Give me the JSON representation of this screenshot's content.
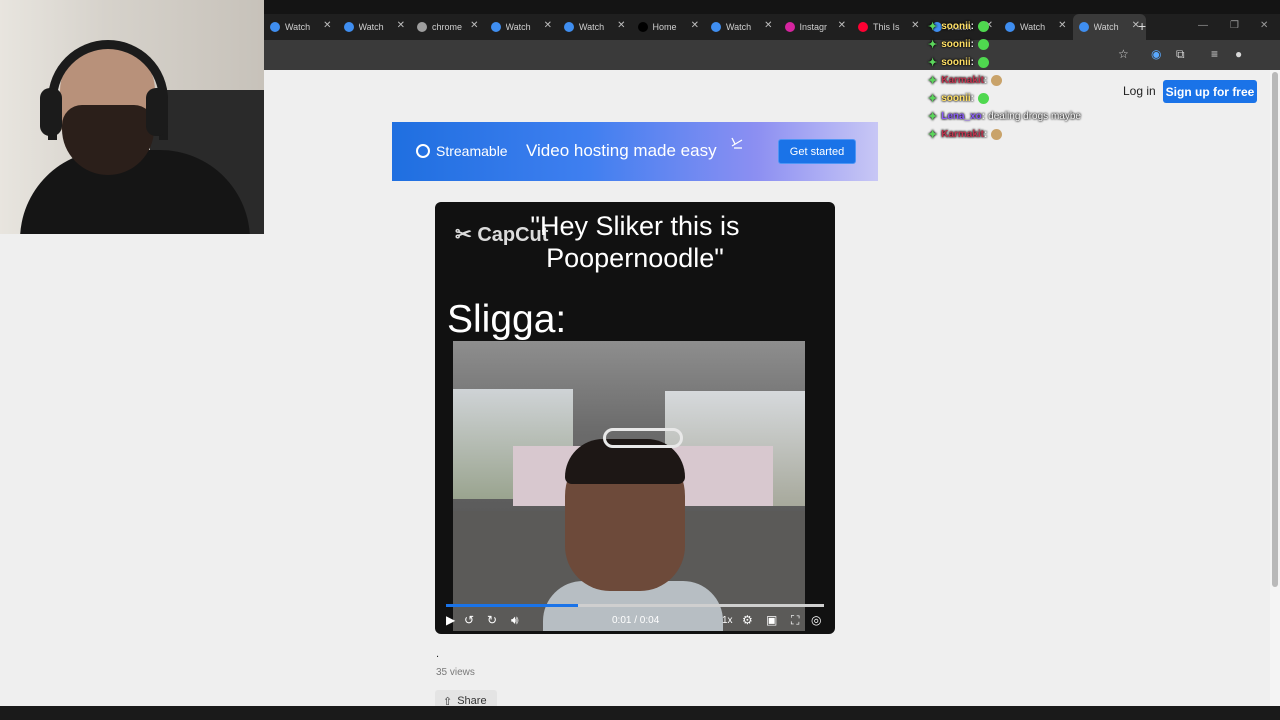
{
  "browser": {
    "tabs": [
      {
        "title": "Watch",
        "icon": "streamable-icon",
        "color": "#3f8ef0",
        "active": false
      },
      {
        "title": "Watch",
        "icon": "streamable-icon",
        "color": "#3f8ef0",
        "active": false
      },
      {
        "title": "chrome",
        "icon": "chrome-icon",
        "color": "#9e9e9e",
        "active": false
      },
      {
        "title": "Watch",
        "icon": "streamable-icon",
        "color": "#3f8ef0",
        "active": false
      },
      {
        "title": "Watch",
        "icon": "streamable-icon",
        "color": "#3f8ef0",
        "active": false
      },
      {
        "title": "Home",
        "icon": "x-icon",
        "color": "#000000",
        "active": false
      },
      {
        "title": "Watch",
        "icon": "streamable-icon",
        "color": "#3f8ef0",
        "active": false
      },
      {
        "title": "Instagr",
        "icon": "instagram-icon",
        "color": "#d6249f",
        "active": false
      },
      {
        "title": "This Is",
        "icon": "youtube-icon",
        "color": "#ff0033",
        "active": false
      },
      {
        "title": "Watch",
        "icon": "streamable-icon",
        "color": "#3f8ef0",
        "active": false
      },
      {
        "title": "Watch",
        "icon": "streamable-icon",
        "color": "#3f8ef0",
        "active": false
      },
      {
        "title": "Watch",
        "icon": "streamable-icon",
        "color": "#3f8ef0",
        "active": true
      }
    ],
    "tab_close": "✕",
    "new_tab": "+"
  },
  "header": {
    "login_label": "Log in",
    "signup_label": "Sign up for free"
  },
  "chat": [
    {
      "user": "soonii",
      "color": "#ffe066",
      "emote_color": "#4fd84f",
      "message": ""
    },
    {
      "user": "soonii",
      "color": "#ffe066",
      "emote_color": "#4fd84f",
      "message": ""
    },
    {
      "user": "soonii",
      "color": "#ffe066",
      "emote_color": "#4fd84f",
      "message": ""
    },
    {
      "user": "Karmakit",
      "color": "#c0334e",
      "emote_color": "#c9a36a",
      "message": ""
    },
    {
      "user": "soonii",
      "color": "#ffe066",
      "emote_color": "#4fd84f",
      "message": ""
    },
    {
      "user": "Lena_xo",
      "color": "#8a5cf6",
      "emote_color": "",
      "message": "dealing drogs maybe"
    },
    {
      "user": "Karmakit",
      "color": "#c0334e",
      "emote_color": "#c9a36a",
      "message": ""
    }
  ],
  "banner": {
    "brand": "Streamable",
    "tagline": "Video hosting made easy",
    "cta": "Get started"
  },
  "video": {
    "watermark": "CapCut",
    "caption_line1": "\"Hey Sliker this is",
    "caption_line2": "Poopernoodle\"",
    "speaker": "Sligga:",
    "time": "0:01 / 0:04",
    "speed": "1x",
    "progress": 0.35
  },
  "meta": {
    "description": ".",
    "views": "35 views",
    "share_label": "Share"
  }
}
